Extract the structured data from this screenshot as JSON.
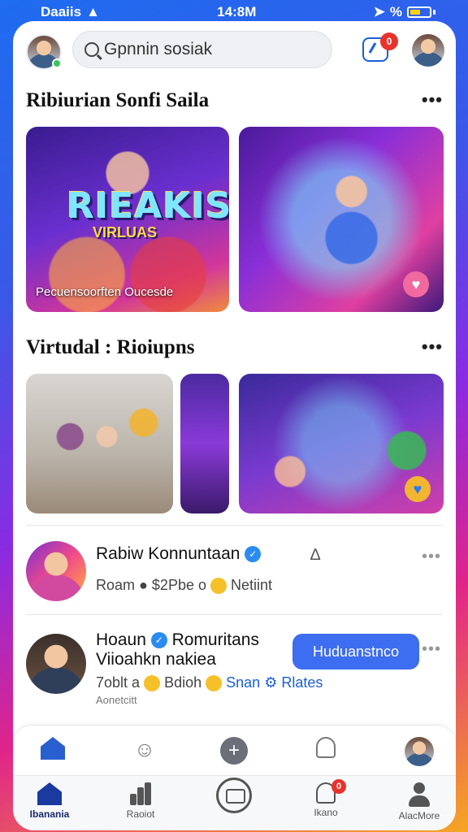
{
  "status_bar": {
    "carrier": "Daaiis",
    "time": "14:8M",
    "battery_pct": "%"
  },
  "header": {
    "search_placeholder": "Gpnnin sosiak",
    "notification_count": "0"
  },
  "sections": {
    "section1": {
      "title": "Ribiurian Sonfi Saila",
      "more": "•••",
      "card1": {
        "logo_text": "RIEAKIS",
        "logo_sub": "VIRLUAS",
        "caption": "Pecuensoorften Oucesde"
      }
    },
    "section2": {
      "title": "Virtudal : Rioiupns",
      "more": "•••"
    }
  },
  "feed": {
    "item1": {
      "name": "Rabiw Konnuntaan",
      "meta_a": "Roam",
      "meta_b": "$2Pbe o",
      "meta_c": "Netiint",
      "more": "•••"
    },
    "item2": {
      "name_line1": "Hoaun",
      "name_line1b": "Romuritans",
      "name_line2": "Viioahkn nakiea",
      "meta_a": "7oblt a",
      "meta_b": "Bdioh",
      "meta_c": "Snan",
      "meta_d": "Rlates",
      "sub": "Aonetcitt",
      "button": "Huduanstnco",
      "more": "•••"
    }
  },
  "tabbar": {
    "tab1": "Ibanania",
    "tab2": "Raoiot",
    "tab3": "",
    "tab4": "Ikano",
    "tab5": "AlacMore",
    "tab4_badge": "0"
  },
  "colors": {
    "accent": "#3d6df0",
    "verified": "#2a8cf0",
    "badge": "#e8322b"
  }
}
